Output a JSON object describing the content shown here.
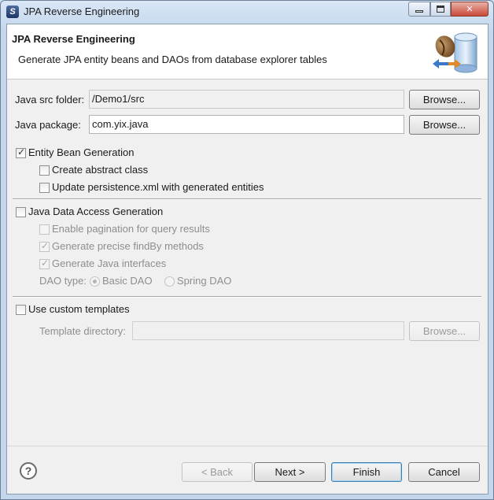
{
  "window": {
    "title": "JPA Reverse Engineering",
    "controls": [
      "minimize-icon",
      "maximize-icon",
      "close-icon"
    ]
  },
  "banner": {
    "title": "JPA Reverse Engineering",
    "description": "Generate JPA entity beans and DAOs from database explorer tables",
    "icon": "database-bean-icon"
  },
  "src_folder": {
    "label": "Java src folder:",
    "value": "/Demo1/src",
    "browse_label": "Browse..."
  },
  "package": {
    "label": "Java package:",
    "value": "com.yix.java",
    "browse_label": "Browse..."
  },
  "entity_section": {
    "label": "Entity Bean Generation",
    "checked": true,
    "options": [
      {
        "label": "Create abstract class",
        "checked": false
      },
      {
        "label": "Update persistence.xml with generated entities",
        "checked": false
      }
    ]
  },
  "dao_section": {
    "label": "Java Data Access Generation",
    "checked": false,
    "options": [
      {
        "label": "Enable pagination for query results",
        "checked": false,
        "enabled": false
      },
      {
        "label": "Generate precise findBy methods",
        "checked": true,
        "enabled": false
      },
      {
        "label": "Generate Java interfaces",
        "checked": true,
        "enabled": false
      }
    ],
    "dao_type_label": "DAO type:",
    "dao_types": [
      {
        "label": "Basic DAO",
        "selected": true
      },
      {
        "label": "Spring DAO",
        "selected": false
      }
    ]
  },
  "templates": {
    "label": "Use custom templates",
    "checked": false,
    "dir_label": "Template directory:",
    "dir_value": "",
    "browse_label": "Browse..."
  },
  "footer": {
    "help_icon": "help-icon",
    "back_label": "< Back",
    "next_label": "Next >",
    "finish_label": "Finish",
    "cancel_label": "Cancel"
  }
}
